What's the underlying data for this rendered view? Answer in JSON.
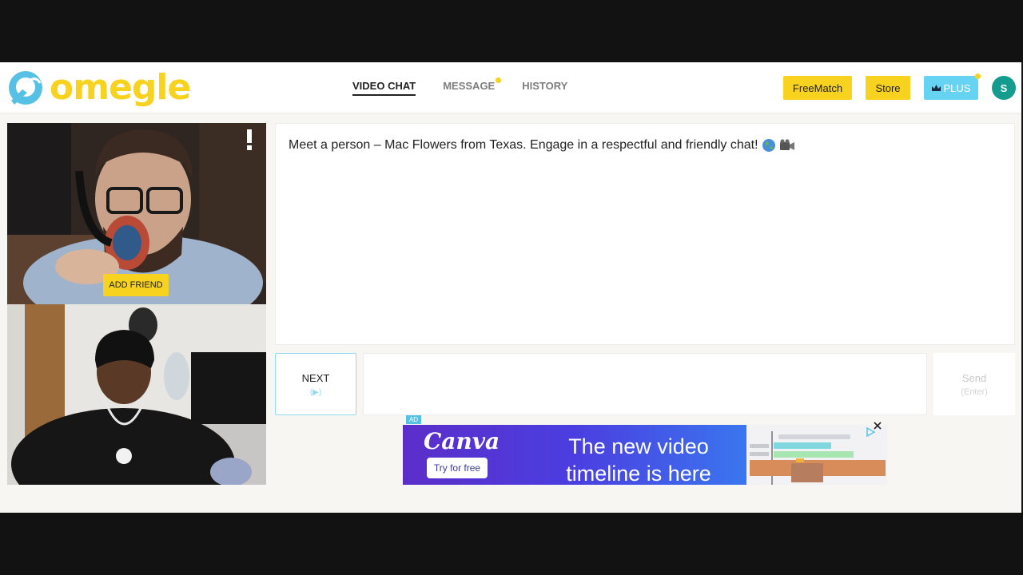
{
  "brand": {
    "logo_text": "omegle",
    "logo_color": "#f7d21e",
    "mark_color": "#56c1e4"
  },
  "nav": {
    "items": [
      {
        "label": "VIDEO CHAT",
        "active": true
      },
      {
        "label": "MESSAGE",
        "active": false,
        "has_dot": true
      },
      {
        "label": "HISTORY",
        "active": false
      }
    ]
  },
  "header_actions": {
    "freematch_label": "FreeMatch",
    "store_label": "Store",
    "plus_label": "PLUS",
    "plus_icon": "crown-icon",
    "avatar_initial": "S"
  },
  "video": {
    "add_friend_label": "ADD FRIEND",
    "report_icon": "report-flag-icon"
  },
  "chat": {
    "system_message": "Meet a person – Mac Flowers from Texas. Engage in a respectful and friendly chat!",
    "message_icons": [
      "globe-icon",
      "video-camera-icon"
    ]
  },
  "controls": {
    "next_label": "NEXT",
    "next_hint": "(▶)",
    "send_label": "Send",
    "send_hint": "(Enter)"
  },
  "ad": {
    "badge": "AD",
    "brand": "Canva",
    "cta": "Try for free",
    "headline": "The new video timeline is here"
  },
  "colors": {
    "accent_yellow": "#f7d21e",
    "accent_cyan": "#67d3f2",
    "avatar_teal": "#149c8e"
  }
}
